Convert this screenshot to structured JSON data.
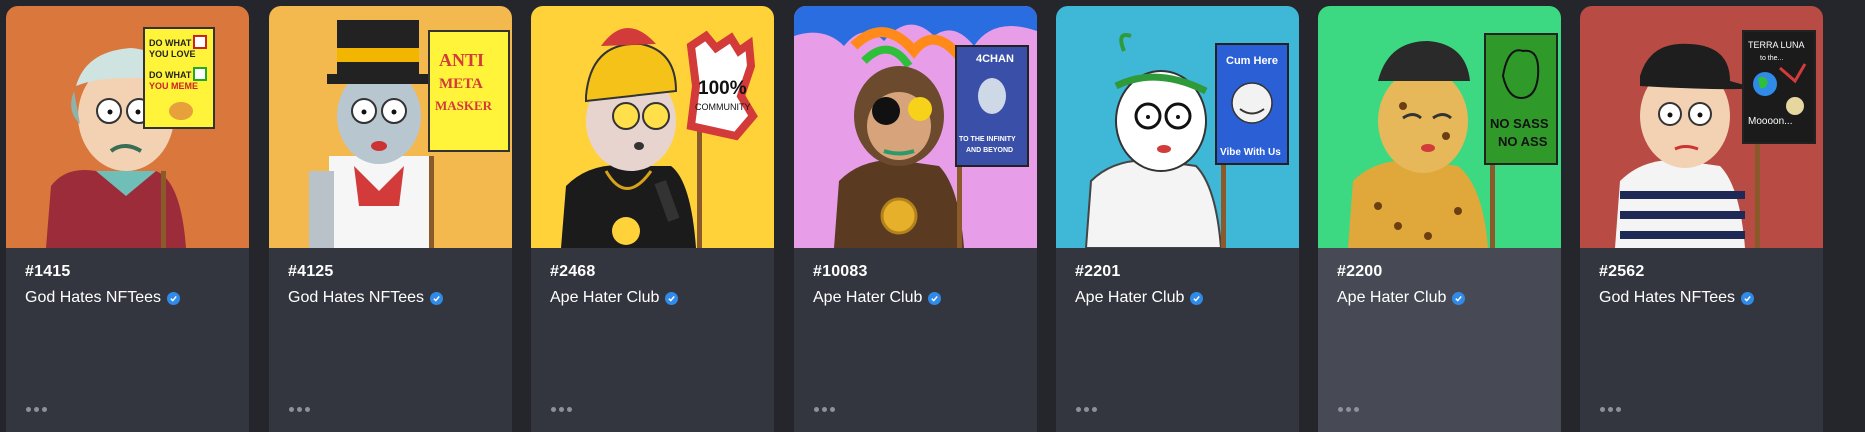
{
  "cards": [
    {
      "token_id": "#1415",
      "collection": "God Hates NFTees",
      "bg": "#d9773d",
      "sign_text": [
        "DO WHAT",
        "YOU LOVE",
        "DO WHAT",
        "YOU MEME"
      ]
    },
    {
      "token_id": "#4125",
      "collection": "God Hates NFTees",
      "bg": "#f4b94e",
      "sign_text": [
        "ANTI",
        "META",
        "MASKER"
      ]
    },
    {
      "token_id": "#2468",
      "collection": "Ape Hater Club",
      "bg": "#ffd23a",
      "sign_text": [
        "100%",
        "COMMUNITY"
      ]
    },
    {
      "token_id": "#10083",
      "collection": "Ape Hater Club",
      "bg": "#e79de8",
      "sign_text": [
        "4CHAN",
        "TO THE INFINITY",
        "AND BEYOND"
      ]
    },
    {
      "token_id": "#2201",
      "collection": "Ape Hater Club",
      "bg": "#3fb8d8",
      "sign_text": [
        "Cum Here",
        "Vibe With Us"
      ]
    },
    {
      "token_id": "#2200",
      "collection": "Ape Hater Club",
      "bg": "#3dd882",
      "sign_text": [
        "NO SASS",
        "NO ASS"
      ]
    },
    {
      "token_id": "#2562",
      "collection": "God Hates NFTees",
      "bg": "#b84b44",
      "sign_text": [
        "TERRA LUNA",
        "to the...",
        "Moooon..."
      ]
    }
  ],
  "verified_icon": "verified-check-badge",
  "more_icon": "more-horizontal-icon",
  "colors": {
    "card_bg": "#34363f",
    "card_hover_bg": "#474a54",
    "page_bg": "#25262b",
    "badge": "#2f8ae8"
  }
}
